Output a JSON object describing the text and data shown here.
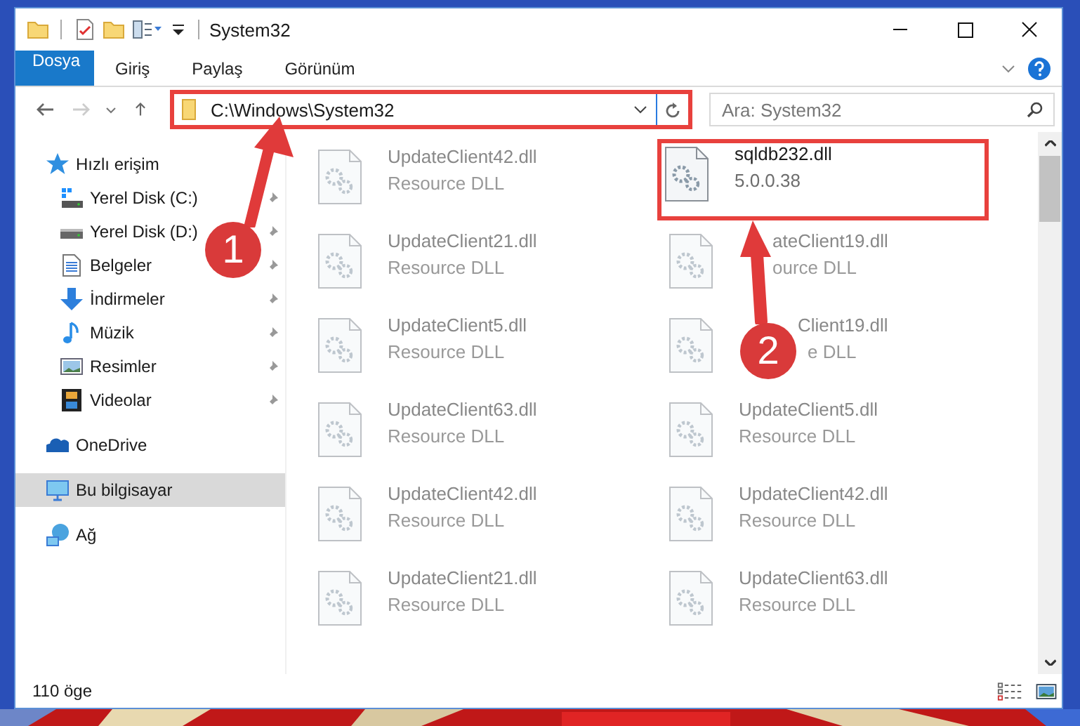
{
  "window": {
    "title": "System32"
  },
  "ribbon_tabs": [
    {
      "label": "Dosya",
      "kind": "file"
    },
    {
      "label": "Giriş",
      "kind": "tab"
    },
    {
      "label": "Paylaş",
      "kind": "tab"
    },
    {
      "label": "Görünüm",
      "kind": "tab"
    }
  ],
  "address_bar": {
    "path": "C:\\Windows\\System32",
    "annotated": true
  },
  "search": {
    "placeholder": "Ara: System32"
  },
  "sidebar": {
    "items": [
      {
        "label": "Hızlı erişim",
        "selected": false,
        "children": [
          {
            "label": "Yerel Disk (C:)",
            "pinned": true,
            "selected": false
          },
          {
            "label": "Yerel Disk (D:)",
            "pinned": true,
            "selected": false
          },
          {
            "label": "Belgeler",
            "pinned": true,
            "selected": false
          },
          {
            "label": "İndirmeler",
            "pinned": true,
            "selected": false
          },
          {
            "label": "Müzik",
            "pinned": true,
            "selected": false
          },
          {
            "label": "Resimler",
            "pinned": true,
            "selected": false
          },
          {
            "label": "Videolar",
            "pinned": true,
            "selected": false
          }
        ]
      },
      {
        "label": "OneDrive",
        "selected": false
      },
      {
        "label": "Bu bilgisayar",
        "selected": true
      },
      {
        "label": "Ağ",
        "selected": false
      }
    ]
  },
  "files": [
    {
      "name": "UpdateClient42.dll",
      "detail": "Resource DLL",
      "blurred": true,
      "annotated": false
    },
    {
      "name": "sqldb232.dll",
      "detail": "5.0.0.38",
      "blurred": false,
      "annotated": true
    },
    {
      "name": "UpdateClient21.dll",
      "detail": "Resource DLL",
      "blurred": true,
      "annotated": false
    },
    {
      "name": "ateClient19.dll",
      "detail": "ource DLL",
      "blurred": true,
      "annotated": false
    },
    {
      "name": "UpdateClient5.dll",
      "detail": "Resource DLL",
      "blurred": true,
      "annotated": false
    },
    {
      "name": "Client19.dll",
      "detail": "e DLL",
      "blurred": true,
      "annotated": false
    },
    {
      "name": "UpdateClient63.dll",
      "detail": "Resource DLL",
      "blurred": true,
      "annotated": false
    },
    {
      "name": "UpdateClient5.dll",
      "detail": "Resource DLL",
      "blurred": true,
      "annotated": false
    },
    {
      "name": "UpdateClient42.dll",
      "detail": "Resource DLL",
      "blurred": true,
      "annotated": false
    },
    {
      "name": "UpdateClient42.dll",
      "detail": "Resource DLL",
      "blurred": true,
      "annotated": false
    },
    {
      "name": "UpdateClient21.dll",
      "detail": "Resource DLL",
      "blurred": true,
      "annotated": false
    },
    {
      "name": "UpdateClient63.dll",
      "detail": "Resource DLL",
      "blurred": true,
      "annotated": false
    }
  ],
  "annotations": [
    {
      "label": "1"
    },
    {
      "label": "2"
    }
  ],
  "status_bar": {
    "count": "110 öge"
  }
}
